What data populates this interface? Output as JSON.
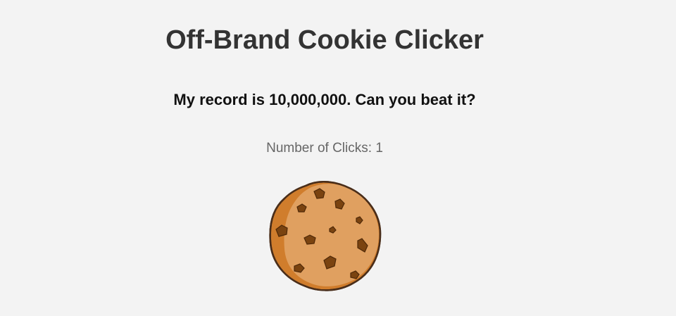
{
  "page": {
    "title": "Off-Brand Cookie Clicker",
    "subtitle": "My record is 10,000,000. Can you beat it?"
  },
  "counter": {
    "label": "Number of Clicks: ",
    "value": "1"
  },
  "cookie": {
    "icon": "cookie-icon",
    "colors": {
      "dough": "#e0a060",
      "shadow": "#d07d2c",
      "outline": "#4a2e1a",
      "chip": "#7a4310",
      "chip_dark": "#4f2908"
    }
  }
}
